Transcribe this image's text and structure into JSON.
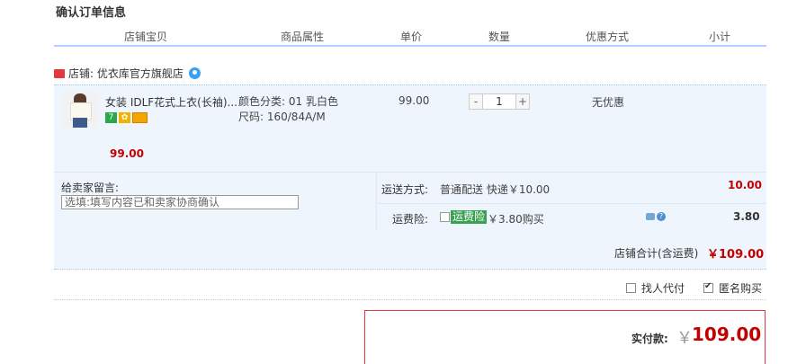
{
  "title": "确认订单信息",
  "columns": [
    "店铺宝贝",
    "商品属性",
    "单价",
    "数量",
    "优惠方式",
    "小计"
  ],
  "shop": {
    "label": "店铺: 优衣库官方旗舰店"
  },
  "item": {
    "name": "女装 IDLF花式上衣(长袖)...",
    "attr_color": "颜色分类: 01 乳白色",
    "attr_size": "尺码: 160/84A/M",
    "unit_price": "99.00",
    "quantity": "1",
    "qty_minus": "-",
    "qty_plus": "+",
    "promo": "无优惠",
    "subtotal": "99.00",
    "badge_7": "7"
  },
  "message": {
    "label": "给卖家留言:",
    "placeholder": "选填:填写内容已和卖家协商确认"
  },
  "shipping": {
    "label": "运送方式:",
    "option": "普通配送 快递￥10.00",
    "price": "10.00"
  },
  "insurance": {
    "label": "运费险:",
    "tag": "运费险",
    "price_text": "￥3.80购买",
    "amount": "3.80"
  },
  "shop_total": {
    "label": "店铺合计(含运费)",
    "value": "￥109.00"
  },
  "options": {
    "proxy_pay": "找人代付",
    "anonymous": "匿名购买",
    "anonymous_checked": true
  },
  "payment": {
    "label": "实付款:",
    "currency": "￥",
    "amount": "109.00"
  },
  "colors": {
    "accent_red": "#c40000",
    "header_line": "#b2d1ff",
    "row_bg": "#eff5fc",
    "insurance_green": "#3aa152"
  },
  "icons": [
    "shop-icon",
    "wangwang-icon",
    "chat-icon",
    "help-icon"
  ]
}
